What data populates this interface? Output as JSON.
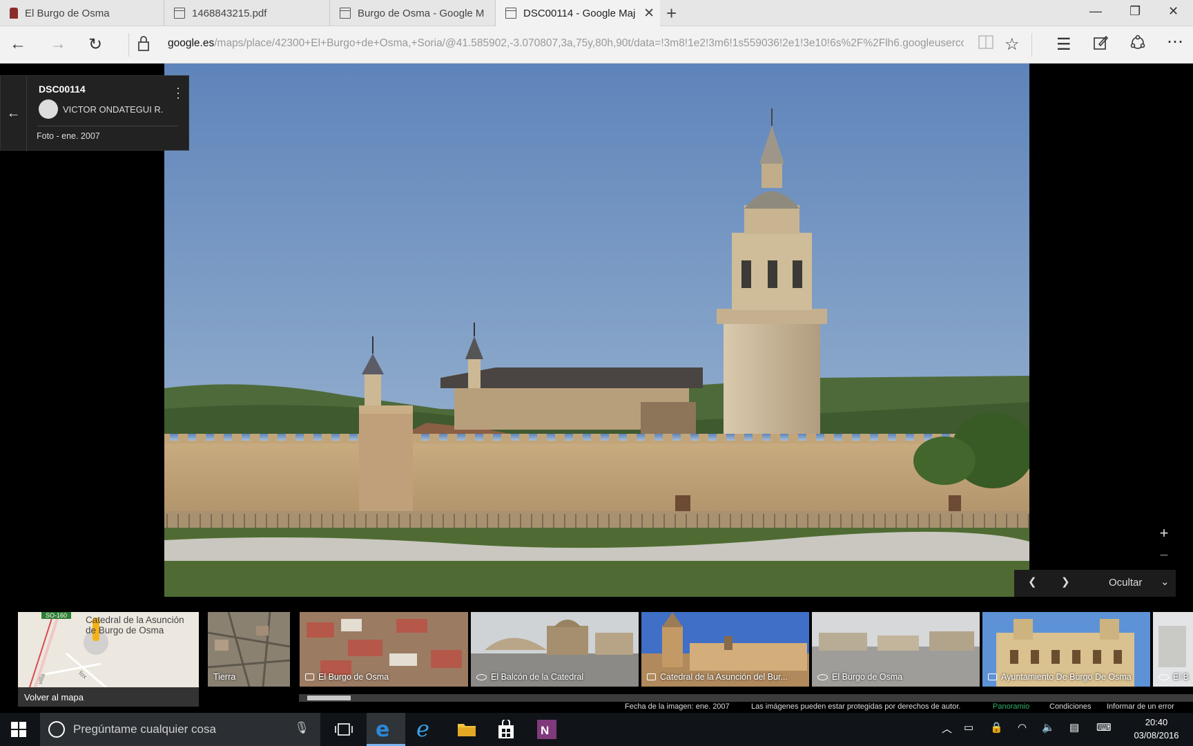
{
  "browser": {
    "tabs": [
      {
        "label": "El Burgo de Osma",
        "icon": "burgo-icon"
      },
      {
        "label": "1468843215.pdf",
        "icon": "page-icon"
      },
      {
        "label": "Burgo de Osma - Google M",
        "icon": "page-icon"
      },
      {
        "label": "DSC00114 - Google Maj",
        "icon": "page-icon",
        "active": true
      }
    ],
    "url_host": "google.es",
    "url_path": "/maps/place/42300+El+Burgo+de+Osma,+Soria/@41.585902,-3.070807,3a,75y,80h,90t/data=!3m8!1e2!3m6!1s559036!2e1!3e10!6s%2F%2Flh6.googleusercor"
  },
  "photo_card": {
    "title": "DSC00114",
    "author": "VICTOR ONDATEGUI R.",
    "date": "Foto - ene. 2007"
  },
  "pager": {
    "hide_label": "Ocultar"
  },
  "filmstrip": {
    "map_place": "Catedral de la Asunción de Burgo de Osma",
    "map_badge": "SO-160",
    "map_street_1": "villa",
    "map_street_2": "fox",
    "back_to_map": "Volver al mapa",
    "thumbs": [
      {
        "label": "Tierra",
        "kind": "earth"
      },
      {
        "label": "El Burgo de Osma",
        "kind": "photo"
      },
      {
        "label": "El Balcón de la Catedral",
        "kind": "pano"
      },
      {
        "label": "Catedral de la Asunción del Bur...",
        "kind": "photo"
      },
      {
        "label": "El Burgo de Osma",
        "kind": "pano"
      },
      {
        "label": "Ayuntamiento De Burgo De Osma",
        "kind": "photo"
      },
      {
        "label": "El B",
        "kind": "pano"
      }
    ],
    "footer": {
      "date": "Fecha de la imagen: ene. 2007",
      "copyright": "Las imágenes pueden estar protegidas por derechos de autor.",
      "brand": "Panoramio",
      "terms": "Condiciones",
      "report": "Informar de un error"
    }
  },
  "taskbar": {
    "search_placeholder": "Pregúntame cualquier cosa",
    "time": "20:40",
    "date": "03/08/2016"
  }
}
